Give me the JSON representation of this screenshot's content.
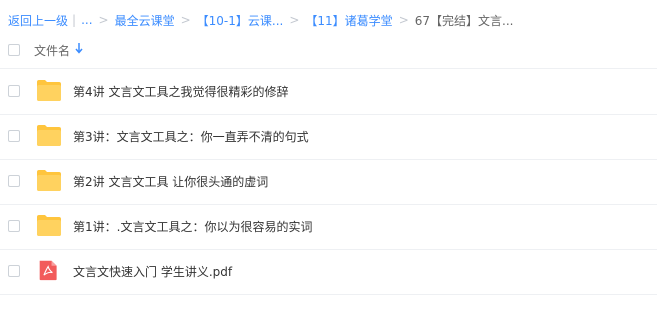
{
  "breadcrumb": {
    "back": "返回上一级",
    "ellipsis": "...",
    "items": [
      "最全云课堂",
      "【10-1】云课...",
      "【11】诸葛学堂"
    ],
    "current": "67【完结】文言..."
  },
  "header": {
    "column_label": "文件名"
  },
  "files": [
    {
      "name": "第4讲 文言文工具之我觉得很精彩的修辞",
      "type": "folder"
    },
    {
      "name": "第3讲：文言文工具之：你一直弄不清的句式",
      "type": "folder"
    },
    {
      "name": "第2讲 文言文工具 让你很头通的虚词",
      "type": "folder"
    },
    {
      "name": "第1讲：.文言文工具之：你以为很容易的实词",
      "type": "folder"
    },
    {
      "name": "文言文快速入门 学生讲义.pdf",
      "type": "pdf"
    }
  ],
  "colors": {
    "accent": "#3b8cff",
    "folder": "#ffc53d",
    "pdf": "#f25b5b"
  }
}
